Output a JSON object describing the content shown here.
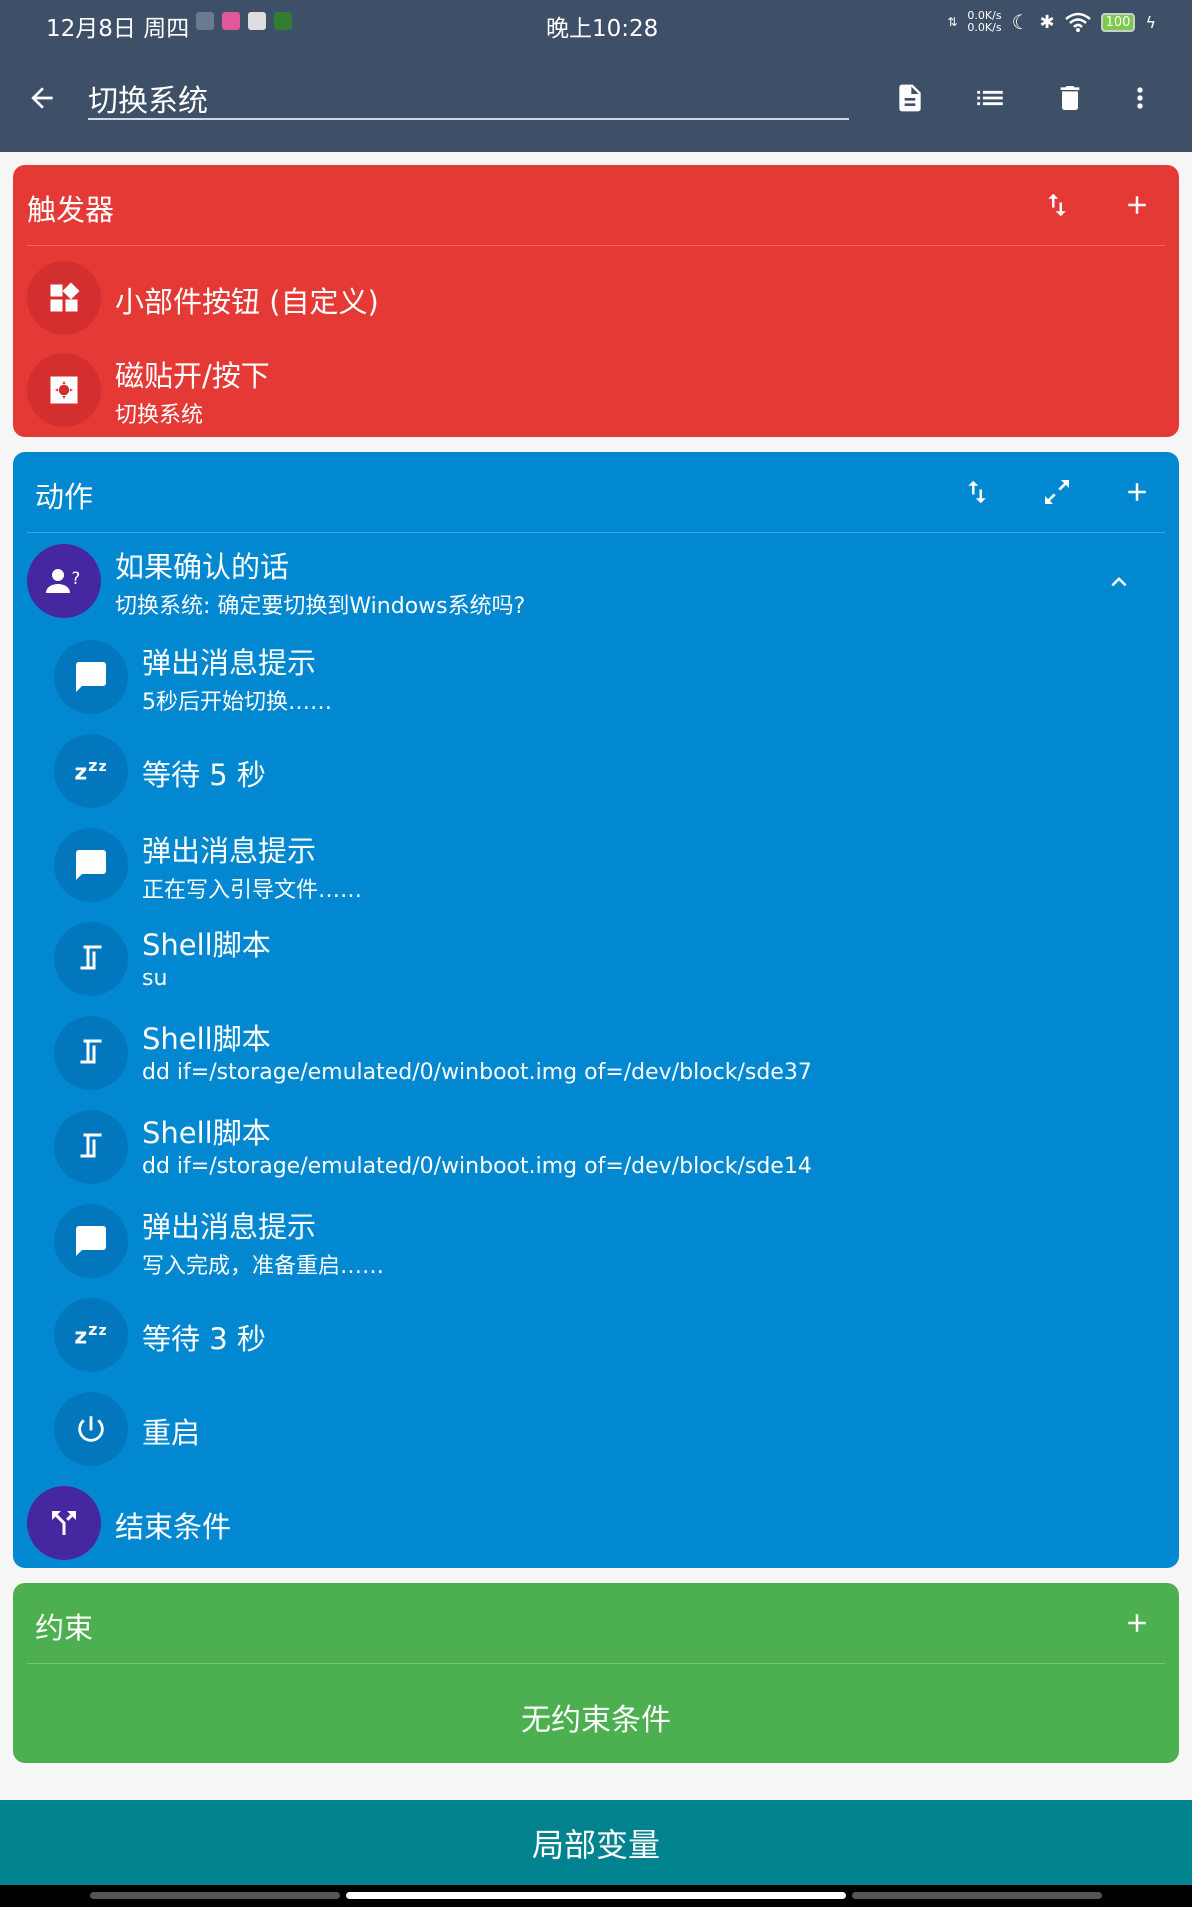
{
  "status_bar": {
    "date_day": "12月8日 周四",
    "time": "晚上10:28",
    "upload_speed": "0.0K/s",
    "download_speed": "0.0K/s",
    "battery": "100"
  },
  "app_bar": {
    "title_value": "切换系统"
  },
  "triggers": {
    "title": "触发器",
    "items": [
      {
        "title": "小部件按钮 (自定义)",
        "subtitle": ""
      },
      {
        "title": "磁贴开/按下",
        "subtitle": "切换系统"
      }
    ]
  },
  "actions": {
    "title": "动作",
    "items": [
      {
        "title": "如果确认的话",
        "subtitle": "切换系统: 确定要切换到Windows系统吗?"
      },
      {
        "title": "弹出消息提示",
        "subtitle": "5秒后开始切换……"
      },
      {
        "title": "等待 5 秒",
        "subtitle": ""
      },
      {
        "title": "弹出消息提示",
        "subtitle": "正在写入引导文件……"
      },
      {
        "title": "Shell脚本",
        "subtitle": "su"
      },
      {
        "title": "Shell脚本",
        "subtitle": "dd if=/storage/emulated/0/winboot.img of=/dev/block/sde37"
      },
      {
        "title": "Shell脚本",
        "subtitle": "dd if=/storage/emulated/0/winboot.img of=/dev/block/sde14"
      },
      {
        "title": "弹出消息提示",
        "subtitle": "写入完成，准备重启……"
      },
      {
        "title": "等待 3 秒",
        "subtitle": ""
      },
      {
        "title": "重启",
        "subtitle": ""
      },
      {
        "title": "结束条件",
        "subtitle": ""
      }
    ]
  },
  "constraints": {
    "title": "约束",
    "empty_text": "无约束条件"
  },
  "bottom": {
    "local_vars_label": "局部变量"
  },
  "colors": {
    "appbar": "#3E5068",
    "trigger": "#E53935",
    "action": "#0288D1",
    "constraint": "#4CAF50",
    "bottom": "#00838F",
    "purple": "#4527A0"
  }
}
